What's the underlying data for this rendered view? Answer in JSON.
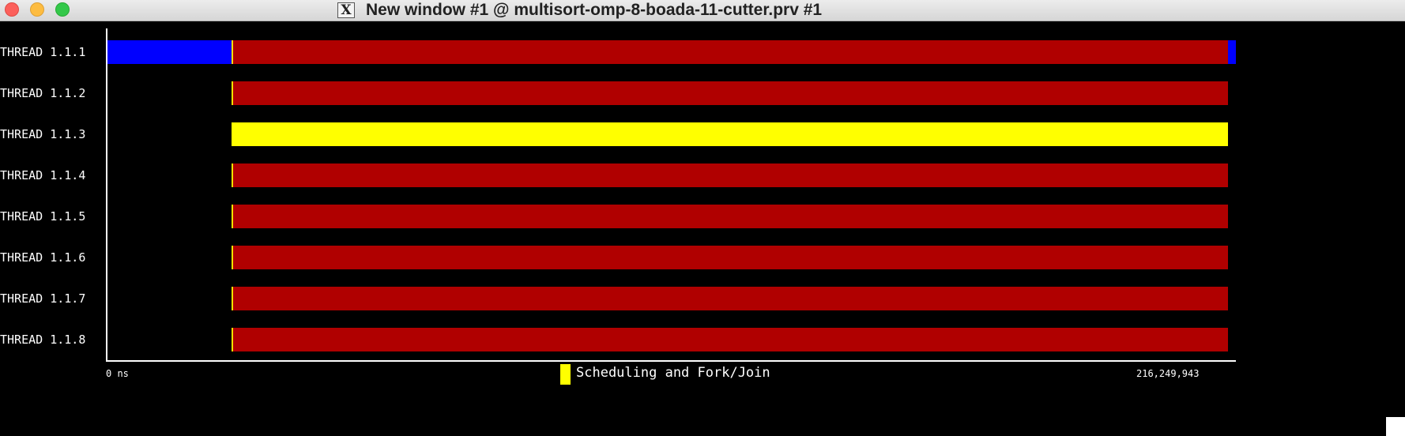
{
  "window": {
    "title": "New window #1 @ multisort-omp-8-boada-11-cutter.prv #1",
    "app_icon": "x-window-icon",
    "buttons": [
      "close",
      "minimize",
      "maximize"
    ]
  },
  "timeline": {
    "threads": [
      {
        "label": "THREAD 1.1.1",
        "segments": [
          {
            "state": "running",
            "start": 0.0,
            "end": 0.11
          },
          {
            "state": "idle",
            "start": 0.11,
            "end": 0.993
          },
          {
            "state": "running",
            "start": 0.993,
            "end": 1.0
          }
        ]
      },
      {
        "label": "THREAD 1.1.2",
        "segments": [
          {
            "state": "idle",
            "start": 0.11,
            "end": 0.993
          }
        ]
      },
      {
        "label": "THREAD 1.1.3",
        "segments": [
          {
            "state": "scheduling",
            "start": 0.11,
            "end": 0.993
          }
        ]
      },
      {
        "label": "THREAD 1.1.4",
        "segments": [
          {
            "state": "idle",
            "start": 0.11,
            "end": 0.993
          }
        ]
      },
      {
        "label": "THREAD 1.1.5",
        "segments": [
          {
            "state": "idle",
            "start": 0.11,
            "end": 0.993
          }
        ]
      },
      {
        "label": "THREAD 1.1.6",
        "segments": [
          {
            "state": "idle",
            "start": 0.11,
            "end": 0.993
          }
        ]
      },
      {
        "label": "THREAD 1.1.7",
        "segments": [
          {
            "state": "idle",
            "start": 0.11,
            "end": 0.993
          }
        ]
      },
      {
        "label": "THREAD 1.1.8",
        "segments": [
          {
            "state": "idle",
            "start": 0.11,
            "end": 0.993
          }
        ]
      }
    ],
    "marker_position": 0.11,
    "start_label": "0 ns",
    "end_label": "216,249,943",
    "legend": {
      "label": "Scheduling and Fork/Join",
      "color": "#ffff00"
    },
    "colors": {
      "running": "#0000ff",
      "idle": "#b00000",
      "scheduling": "#ffff00",
      "marker": "#ffe000",
      "background": "#000000",
      "axis": "#ffffff"
    }
  }
}
